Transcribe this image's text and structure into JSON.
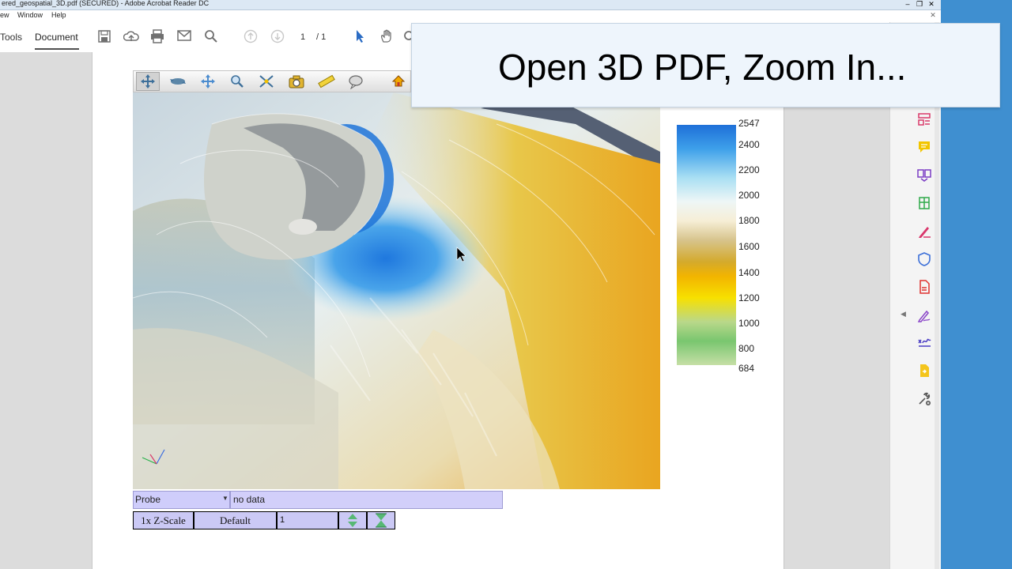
{
  "window": {
    "title": "ered_geospatial_3D.pdf (SECURED) - Adobe Acrobat Reader DC",
    "buttons": {
      "minimize": "–",
      "maximize": "❐",
      "close": "✕",
      "doc_close": "✕"
    }
  },
  "menu": {
    "items": [
      "ew",
      "Window",
      "Help"
    ]
  },
  "toolbar": {
    "tabs": [
      "Tools",
      "Document"
    ],
    "active_tab": "Document",
    "icons": [
      "save-icon",
      "upload-icon",
      "print-icon",
      "email-icon",
      "search-icon",
      "page-up-icon",
      "page-down-icon",
      "select-cursor-icon",
      "hand-tool-icon",
      "zoom-icon"
    ],
    "current_page": "1",
    "page_separator": "/",
    "total_pages": "1"
  },
  "banner": {
    "text": "Open 3D PDF, Zoom In..."
  },
  "toolbar3d": {
    "icons": [
      "rotate-icon",
      "spin-icon",
      "pan-icon",
      "zoom-3d-icon",
      "walk-icon",
      "camera-icon",
      "measure-icon",
      "comment-icon",
      "home-icon"
    ]
  },
  "legend": {
    "labels": [
      "2547",
      "2400",
      "2200",
      "2000",
      "1800",
      "1600",
      "1400",
      "1200",
      "1000",
      "800",
      "684"
    ],
    "min": 684,
    "max": 2547,
    "colors": [
      "#1e6fd8",
      "#3ea0ea",
      "#a9dff3",
      "#eef6f6",
      "#d7c48c",
      "#f2b400",
      "#f7e000",
      "#79c66f",
      "#c6dfa6"
    ]
  },
  "probe": {
    "mode": "Probe",
    "output": "no data",
    "zscale_label": "1x Z-Scale",
    "default_label": "Default",
    "zscale_value": "1"
  },
  "right_panel": {
    "icons": [
      "organize-pages-icon",
      "comment-icon",
      "combine-files-icon",
      "export-pdf-icon",
      "fill-sign-icon",
      "protect-icon",
      "create-pdf-icon",
      "edit-pdf-icon",
      "sign-icon",
      "send-review-icon",
      "more-tools-icon"
    ]
  },
  "colors": {
    "desktop": "#3f8fd0",
    "accent": "#d93a6a",
    "probe_bg": "#cfcdfb"
  }
}
